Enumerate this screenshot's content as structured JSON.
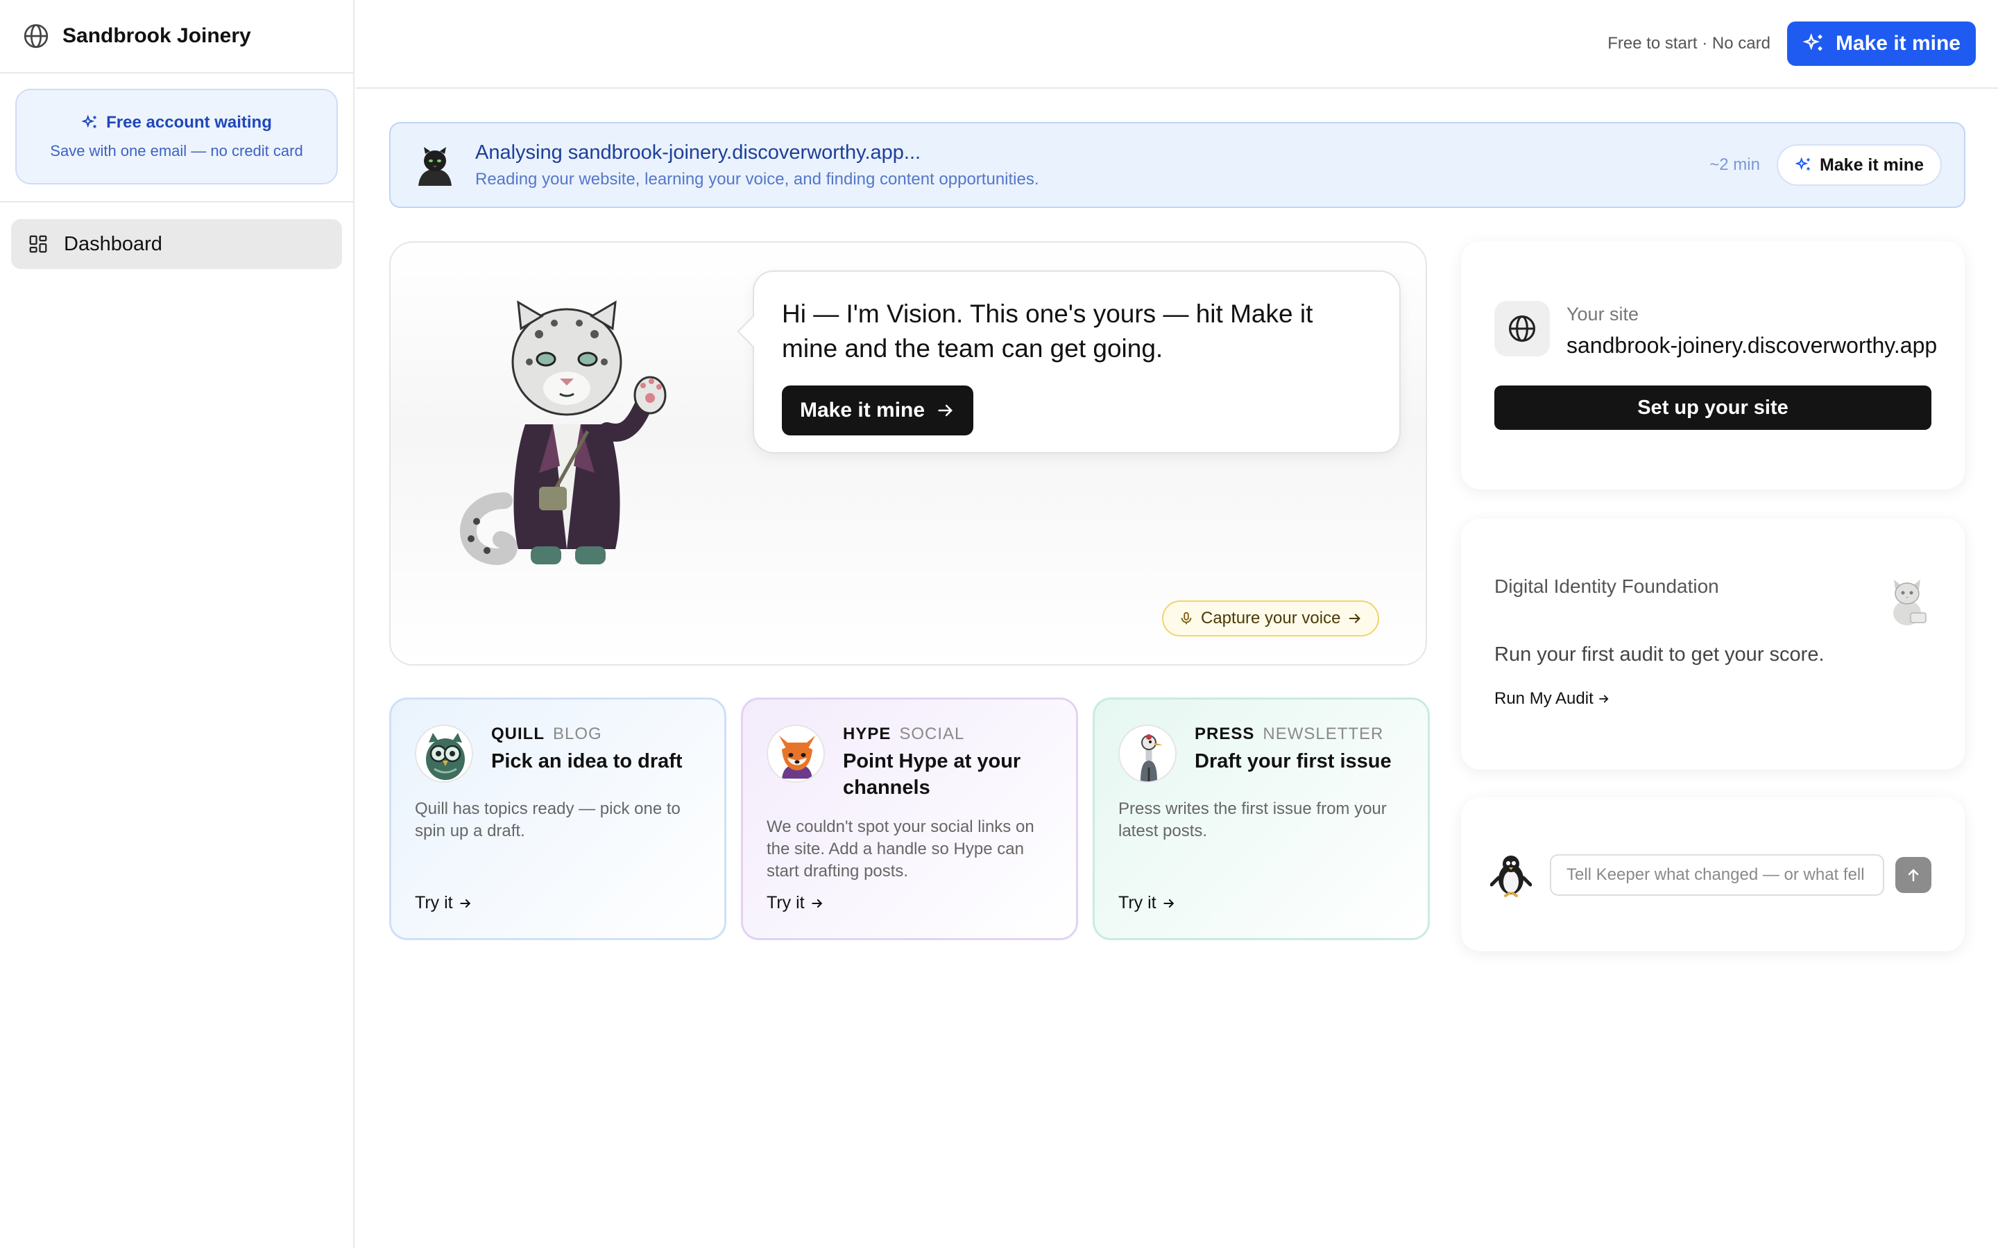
{
  "app": {
    "name": "Sandbrook Joinery",
    "icon": "globe-icon"
  },
  "sidebar": {
    "free_account": {
      "title": "Free account waiting",
      "subtitle": "Save with one email — no credit card",
      "icon": "sparkle-icon"
    },
    "nav": [
      {
        "label": "Dashboard",
        "icon": "grid-icon",
        "active": true
      }
    ]
  },
  "header": {
    "note": "Free to start · No card",
    "cta_label": "Make it mine"
  },
  "banner": {
    "title": "Analysing sandbrook-joinery.discoverworthy.app...",
    "subtitle": "Reading your website, learning your voice, and finding content opportunities.",
    "eta": "~2 min",
    "cta_label": "Make it mine"
  },
  "vision": {
    "message": "Hi — I'm Vision. This one's yours — hit Make it mine and the team can get going.",
    "cta_label": "Make it mine",
    "voice_label": "Capture your voice"
  },
  "agents": [
    {
      "name": "QUILL",
      "type": "BLOG",
      "headline": "Pick an idea to draft",
      "description": "Quill has topics ready — pick one to spin up a draft.",
      "action": "Try it",
      "icon": "owl-icon"
    },
    {
      "name": "HYPE",
      "type": "SOCIAL",
      "headline": "Point Hype at your channels",
      "description": "We couldn't spot your social links on the site. Add a handle so Hype can start drafting posts.",
      "action": "Try it",
      "icon": "fox-icon"
    },
    {
      "name": "PRESS",
      "type": "NEWSLETTER",
      "headline": "Draft your first issue",
      "description": "Press writes the first issue from your latest posts.",
      "action": "Try it",
      "icon": "crane-icon"
    }
  ],
  "site": {
    "label": "Your site",
    "url": "sandbrook-joinery.discoverworthy.app",
    "button": "Set up your site"
  },
  "identity": {
    "title": "Digital Identity Foundation",
    "subtitle": "Run your first audit to get your score.",
    "link": "Run My Audit"
  },
  "keeper": {
    "placeholder": "Tell Keeper what changed — or what fell short",
    "send_icon": "arrow-up-icon"
  },
  "colors": {
    "primary": "#1f5bf0",
    "dark": "#141414",
    "banner_bg": "#eaf2fd"
  }
}
